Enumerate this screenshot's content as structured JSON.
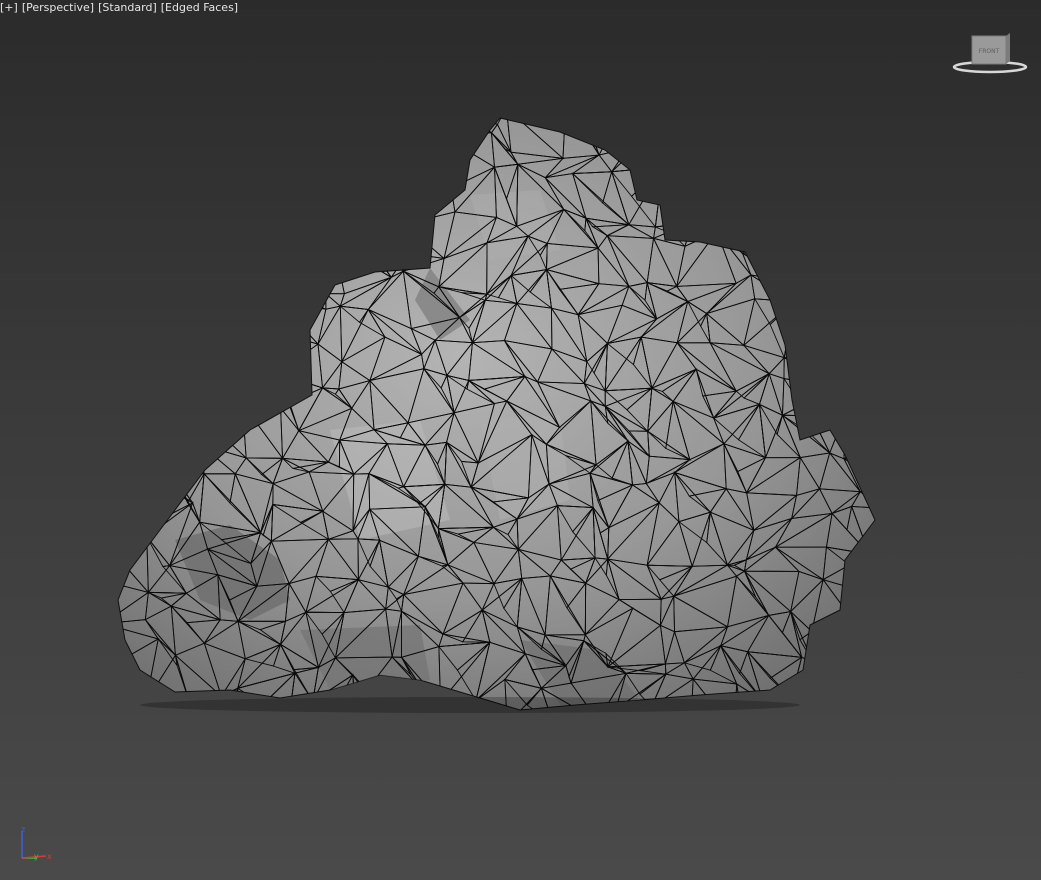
{
  "viewport": {
    "labels": {
      "plus": "[+]",
      "view": "[Perspective]",
      "shading": "[Standard]",
      "display": "[Edged Faces]"
    },
    "viewcube": {
      "face_label": "FRONT"
    },
    "axis_gizmo": {
      "x": "x",
      "y": "y",
      "z": "z"
    },
    "colors": {
      "mesh_fill": "#8e8e8e",
      "mesh_edges": "#0b0b0b",
      "x_axis": "#d43a3a",
      "y_axis": "#3ac53a",
      "z_axis": "#3a60e0"
    }
  }
}
